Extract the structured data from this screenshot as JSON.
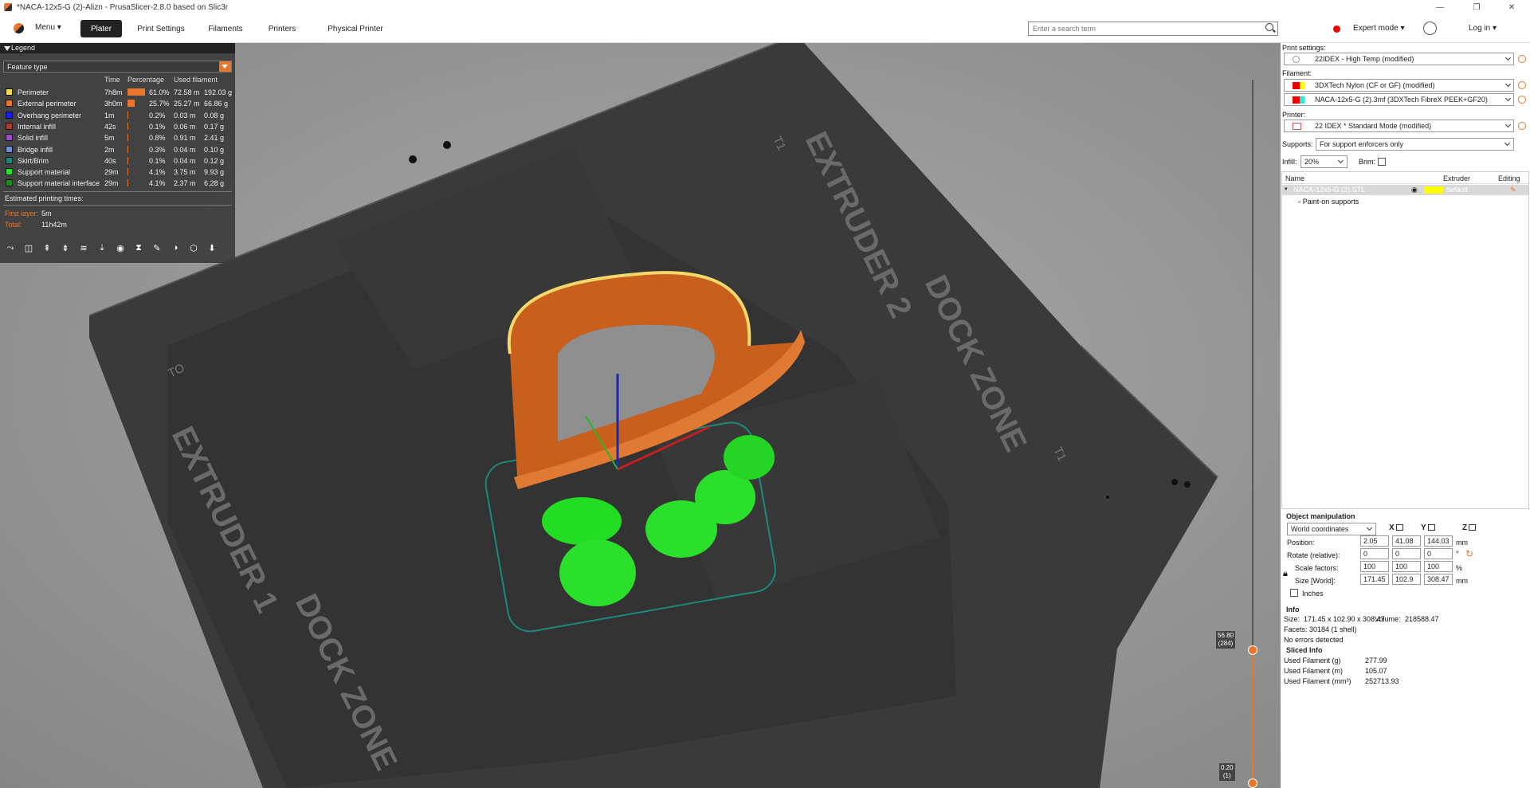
{
  "window": {
    "title": "*NACA-12x5-G (2)-Alizn - PrusaSlicer-2.8.0 based on Slic3r"
  },
  "tabbar": {
    "menu": "Menu",
    "tabs": [
      "Plater",
      "Print Settings",
      "Filaments",
      "Printers",
      "Physical Printer"
    ],
    "search_placeholder": "Enter a search term",
    "mode": "Expert mode",
    "login": "Log in"
  },
  "legend": {
    "title": "Legend",
    "view_type": "Feature type",
    "headers": {
      "time": "Time",
      "percentage": "Percentage",
      "used": "Used filament"
    },
    "rows": [
      {
        "name": "Perimeter",
        "color": "#f5e04a",
        "time": "7h8m",
        "pct": "61.0%",
        "pct_value": 61.0,
        "len": "72.58 m",
        "wt": "192.03 g"
      },
      {
        "name": "External perimeter",
        "color": "#e8762b",
        "time": "3h0m",
        "pct": "25.7%",
        "pct_value": 25.7,
        "len": "25.27 m",
        "wt": "66.86 g"
      },
      {
        "name": "Overhang perimeter",
        "color": "#1a1aff",
        "time": "1m",
        "pct": "0.2%",
        "pct_value": 0.2,
        "len": "0.03 m",
        "wt": "0.08 g"
      },
      {
        "name": "Internal infill",
        "color": "#b03a2e",
        "time": "42s",
        "pct": "0.1%",
        "pct_value": 0.1,
        "len": "0.06 m",
        "wt": "0.17 g"
      },
      {
        "name": "Solid infill",
        "color": "#9a4fc9",
        "time": "5m",
        "pct": "0.8%",
        "pct_value": 0.8,
        "len": "0.91 m",
        "wt": "2.41 g"
      },
      {
        "name": "Bridge infill",
        "color": "#6f8fd0",
        "time": "2m",
        "pct": "0.3%",
        "pct_value": 0.3,
        "len": "0.04 m",
        "wt": "0.10 g"
      },
      {
        "name": "Skirt/Brim",
        "color": "#1b8a7a",
        "time": "40s",
        "pct": "0.1%",
        "pct_value": 0.1,
        "len": "0.04 m",
        "wt": "0.12 g"
      },
      {
        "name": "Support material",
        "color": "#27e22b",
        "time": "29m",
        "pct": "4.1%",
        "pct_value": 4.1,
        "len": "3.75 m",
        "wt": "9.93 g"
      },
      {
        "name": "Support material interface",
        "color": "#1f8a22",
        "time": "29m",
        "pct": "4.1%",
        "pct_value": 4.1,
        "len": "2.37 m",
        "wt": "6.28 g"
      }
    ],
    "est_label": "Estimated printing times:",
    "first_layer_label": "First layer:",
    "first_layer": "5m",
    "total_label": "Total:",
    "total": "11h42m"
  },
  "slider": {
    "top_value": "56.80",
    "top_layer": "(284)",
    "bottom_value": "0.20",
    "bottom_layer": "(1)"
  },
  "bed": {
    "extruder1": "EXTRUDER 1",
    "extruder2": "EXTRUDER 2",
    "dock": "DOCK ZONE",
    "to": "TO",
    "t1": "T1"
  },
  "right": {
    "print_settings_label": "Print settings:",
    "print_settings": "22IDEX - High Temp (modified)",
    "filament_label": "Filament:",
    "filament1": "3DXTech Nylon (CF or GF) (modified)",
    "filament2": "NACA-12x5-G (2).3mf (3DXTech FibreX PEEK+GF20)",
    "printer_label": "Printer:",
    "printer": "22 IDEX * Standard Mode (modified)",
    "supports_label": "Supports:",
    "supports": "For support enforcers only",
    "infill_label": "Infill:",
    "infill": "20%",
    "brim_label": "Brim:",
    "col_name": "Name",
    "col_extruder": "Extruder",
    "col_editing": "Editing",
    "object_name": "NACA-12x5-G (2).STL",
    "object_extruder": "default",
    "paint_on": "Paint-on supports",
    "om_title": "Object manipulation",
    "coords": "World coordinates",
    "axis_x": "X",
    "axis_y": "Y",
    "axis_z": "Z",
    "position_label": "Position:",
    "pos": [
      "2.05",
      "41.08",
      "144.03"
    ],
    "rotate_label": "Rotate (relative):",
    "rot": [
      "0",
      "0",
      "0"
    ],
    "scale_label": "Scale factors:",
    "scale": [
      "100",
      "100",
      "100"
    ],
    "size_label": "Size [World]:",
    "size": [
      "171.45",
      "102.9",
      "308.47"
    ],
    "unit_mm": "mm",
    "unit_deg": "°",
    "unit_pct": "%",
    "inches": "Inches",
    "info_title": "Info",
    "size_info_label": "Size:",
    "size_info": "171.45 x 102.90 x 308.47",
    "volume_label": "Volume:",
    "volume": "218588.47",
    "facets_label": "Facets:",
    "facets": "30184 (1 shell)",
    "errors": "No errors detected",
    "sliced_title": "Sliced Info",
    "used_g_label": "Used Filament (g)",
    "used_g": "277.99",
    "used_m_label": "Used Filament (m)",
    "used_m": "105.07",
    "used_mm3_label": "Used Filament (mm³)",
    "used_mm3": "252713.93"
  }
}
